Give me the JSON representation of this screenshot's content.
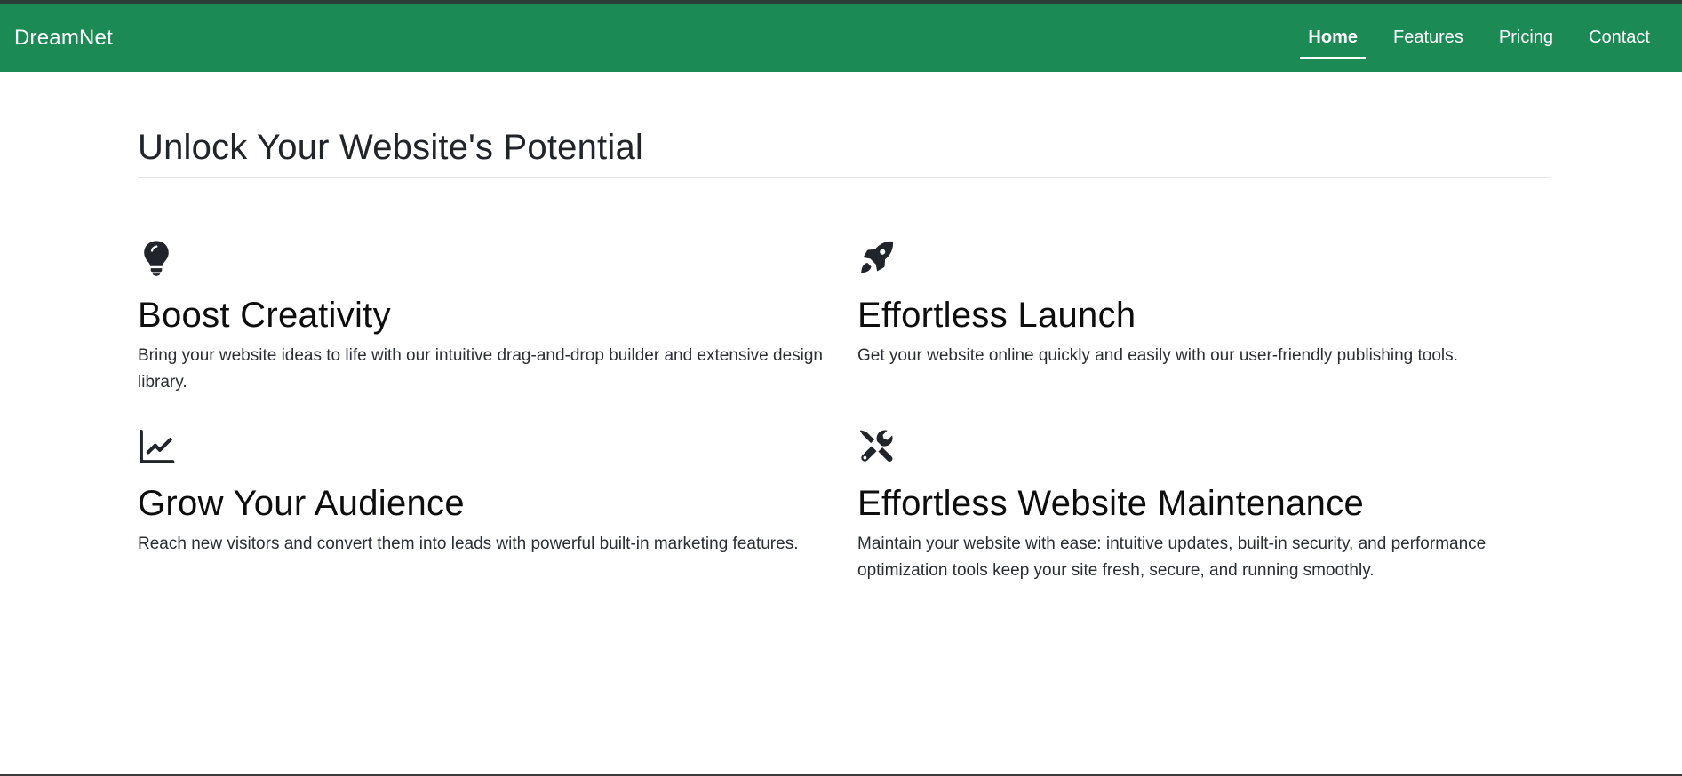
{
  "navbar": {
    "brand": "DreamNet",
    "links": [
      {
        "label": "Home",
        "active": true
      },
      {
        "label": "Features",
        "active": false
      },
      {
        "label": "Pricing",
        "active": false
      },
      {
        "label": "Contact",
        "active": false
      }
    ],
    "background_color": "#1b8a55"
  },
  "main": {
    "title": "Unlock Your Website's Potential",
    "features": [
      {
        "icon": "lightbulb-icon",
        "title": "Boost Creativity",
        "description": "Bring your website ideas to life with our intuitive drag-and-drop builder and extensive design library."
      },
      {
        "icon": "rocket-icon",
        "title": "Effortless Launch",
        "description": "Get your website online quickly and easily with our user-friendly publishing tools."
      },
      {
        "icon": "line-chart-icon",
        "title": "Grow Your Audience",
        "description": "Reach new visitors and convert them into leads with powerful built-in marketing features."
      },
      {
        "icon": "tools-icon",
        "title": "Effortless Website Maintenance",
        "description": "Maintain your website with ease: intuitive updates, built-in security, and performance optimization tools keep your site fresh, secure, and running smoothly."
      }
    ]
  }
}
